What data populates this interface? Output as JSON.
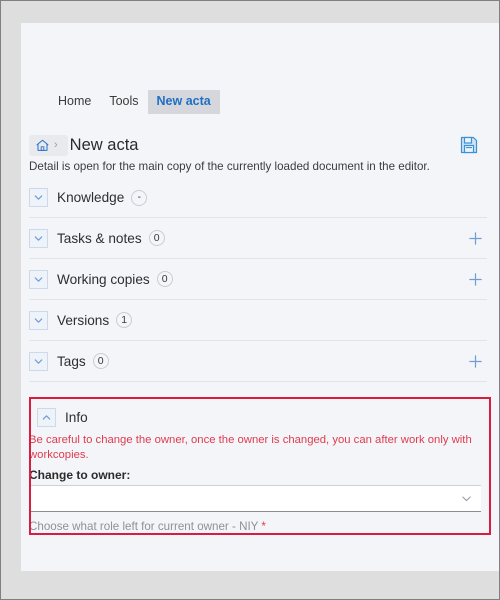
{
  "window": {
    "tabs": [
      {
        "label": "Home",
        "active": false
      },
      {
        "label": "Tools",
        "active": false
      },
      {
        "label": "New acta",
        "active": true
      }
    ]
  },
  "breadcrumb": {
    "home_icon": "home-icon",
    "separator": "›",
    "title": "New acta",
    "save_icon": "save-icon"
  },
  "description": "Detail is open for the main copy of the currently loaded document in the editor.",
  "sections": [
    {
      "label": "Knowledge",
      "badge": "-",
      "has_add": false,
      "expanded": false
    },
    {
      "label": "Tasks & notes",
      "badge": "0",
      "has_add": true,
      "expanded": false
    },
    {
      "label": "Working copies",
      "badge": "0",
      "has_add": true,
      "expanded": false
    },
    {
      "label": "Versions",
      "badge": "1",
      "has_add": false,
      "expanded": false
    },
    {
      "label": "Tags",
      "badge": "0",
      "has_add": true,
      "expanded": false
    }
  ],
  "info": {
    "title": "Info",
    "warning": "Be careful to change the owner, once the owner is changed, you can after work only with workcopies.",
    "field_label": "Change to owner:",
    "select_value": "",
    "select_placeholder": "",
    "helper_text": "Choose what role left for current owner - NIY",
    "required_marker": "*",
    "highlight_color": "#d81d3f"
  },
  "colors": {
    "accent_blue": "#1f6fc4",
    "warning_red": "#e03b4e",
    "highlight_red": "#d81d3f",
    "page_bg": "#f4f5f9",
    "frame_bg": "#dedede"
  }
}
